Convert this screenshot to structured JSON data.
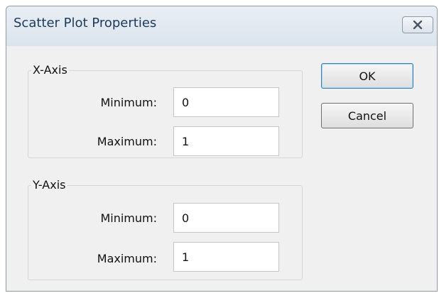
{
  "window": {
    "title": "Scatter Plot Properties",
    "close_icon": "close-icon"
  },
  "x_axis": {
    "legend": "X-Axis",
    "minimum_label": "Minimum:",
    "minimum_value": "0",
    "maximum_label": "Maximum:",
    "maximum_value": "1"
  },
  "y_axis": {
    "legend": "Y-Axis",
    "minimum_label": "Minimum:",
    "minimum_value": "0",
    "maximum_label": "Maximum:",
    "maximum_value": "1"
  },
  "buttons": {
    "ok_label": "OK",
    "cancel_label": "Cancel"
  },
  "colors": {
    "title_text": "#1e3a5a",
    "dialog_background": "#f0f0f0",
    "default_button_border": "#3c7fb1"
  }
}
